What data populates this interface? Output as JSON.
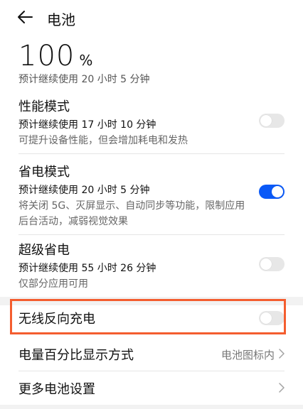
{
  "header": {
    "title": "电池"
  },
  "battery": {
    "percent": "100",
    "unit": "%",
    "remaining": "预计继续使用 20 小时 5 分钟"
  },
  "modes": [
    {
      "title": "性能模式",
      "remaining": "预计继续使用 17 小时 10 分钟",
      "desc": "可提升设备性能，但会增加耗电和发热",
      "enabled": false
    },
    {
      "title": "省电模式",
      "remaining": "预计继续使用 20 小时 5 分钟",
      "desc": "将关闭 5G、灭屏显示、自动同步等功能，限制应用后台活动，减弱视觉效果",
      "enabled": true
    },
    {
      "title": "超级省电",
      "remaining": "预计继续使用 55 小时 26 分钟",
      "desc": "仅部分应用可用",
      "enabled": false
    }
  ],
  "settings": [
    {
      "label": "无线反向充电",
      "enabled": false
    },
    {
      "label": "电量百分比显示方式",
      "value": "电池图标内",
      "chevron": "chevron-right"
    },
    {
      "label": "更多电池设置",
      "chevron": "chevron-right"
    }
  ],
  "colors": {
    "accent": "#0a59f7",
    "highlight": "#f45d2f",
    "toggle_off": "#e7e7e7"
  }
}
